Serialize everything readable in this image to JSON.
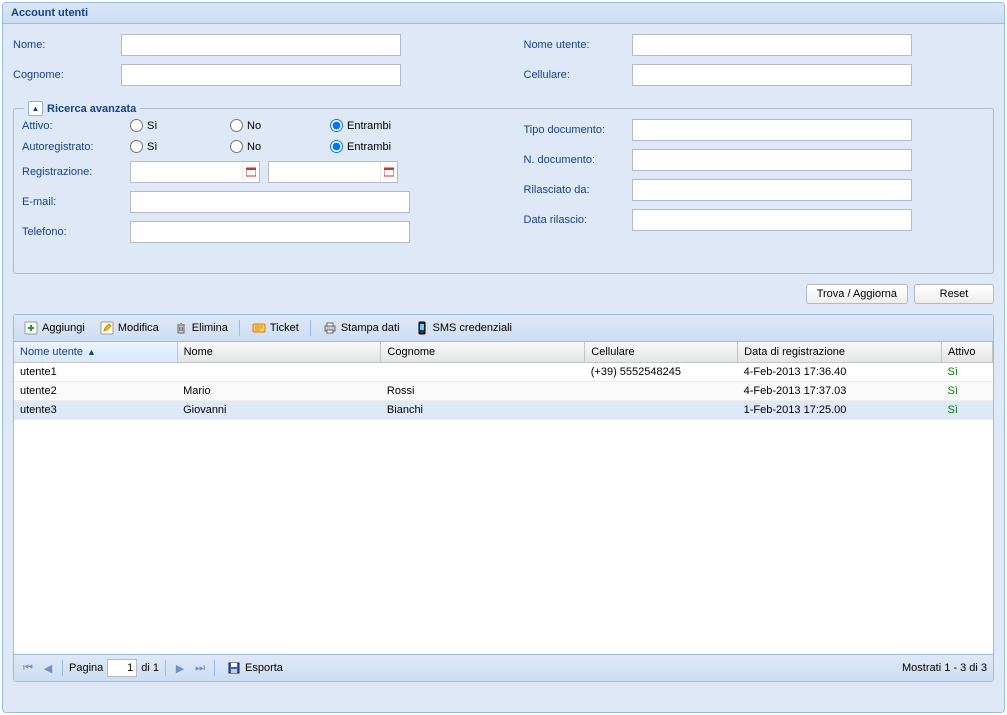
{
  "panel_title": "Account utenti",
  "basic_search": {
    "nome_label": "Nome:",
    "cognome_label": "Cognome:",
    "nome_utente_label": "Nome utente:",
    "cellulare_label": "Cellulare:"
  },
  "advanced": {
    "legend": "Ricerca avanzata",
    "attivo_label": "Attivo:",
    "autoregistrato_label": "Autoregistrato:",
    "registrazione_label": "Registrazione:",
    "email_label": "E-mail:",
    "telefono_label": "Telefono:",
    "tipo_doc_label": "Tipo documento:",
    "n_doc_label": "N. documento:",
    "rilasciato_label": "Rilasciato da:",
    "data_rilascio_label": "Data rilascio:",
    "radio_si": "Sì",
    "radio_no": "No",
    "radio_entrambi": "Entrambi"
  },
  "buttons": {
    "search": "Trova / Aggiorna",
    "reset": "Reset"
  },
  "toolbar": {
    "aggiungi": "Aggiungi",
    "modifica": "Modifica",
    "elimina": "Elimina",
    "ticket": "Ticket",
    "stampa": "Stampa dati",
    "sms": "SMS credenziali",
    "esporta": "Esporta"
  },
  "grid": {
    "headers": {
      "nome_utente": "Nome utente",
      "nome": "Nome",
      "cognome": "Cognome",
      "cellulare": "Cellulare",
      "data_reg": "Data di registrazione",
      "attivo": "Attivo"
    },
    "rows": [
      {
        "nome_utente": "utente1",
        "nome": "",
        "cognome": "",
        "cellulare": "(+39) 5552548245",
        "data_reg": "4-Feb-2013 17:36.40",
        "attivo": "Sì"
      },
      {
        "nome_utente": "utente2",
        "nome": "Mario",
        "cognome": "Rossi",
        "cellulare": "",
        "data_reg": "4-Feb-2013 17:37.03",
        "attivo": "Sì"
      },
      {
        "nome_utente": "utente3",
        "nome": "Giovanni",
        "cognome": "Bianchi",
        "cellulare": "",
        "data_reg": "1-Feb-2013 17:25.00",
        "attivo": "Sì"
      }
    ]
  },
  "paging": {
    "pagina": "Pagina",
    "current": "1",
    "di": "di 1",
    "display": "Mostrati 1 - 3 di 3"
  }
}
